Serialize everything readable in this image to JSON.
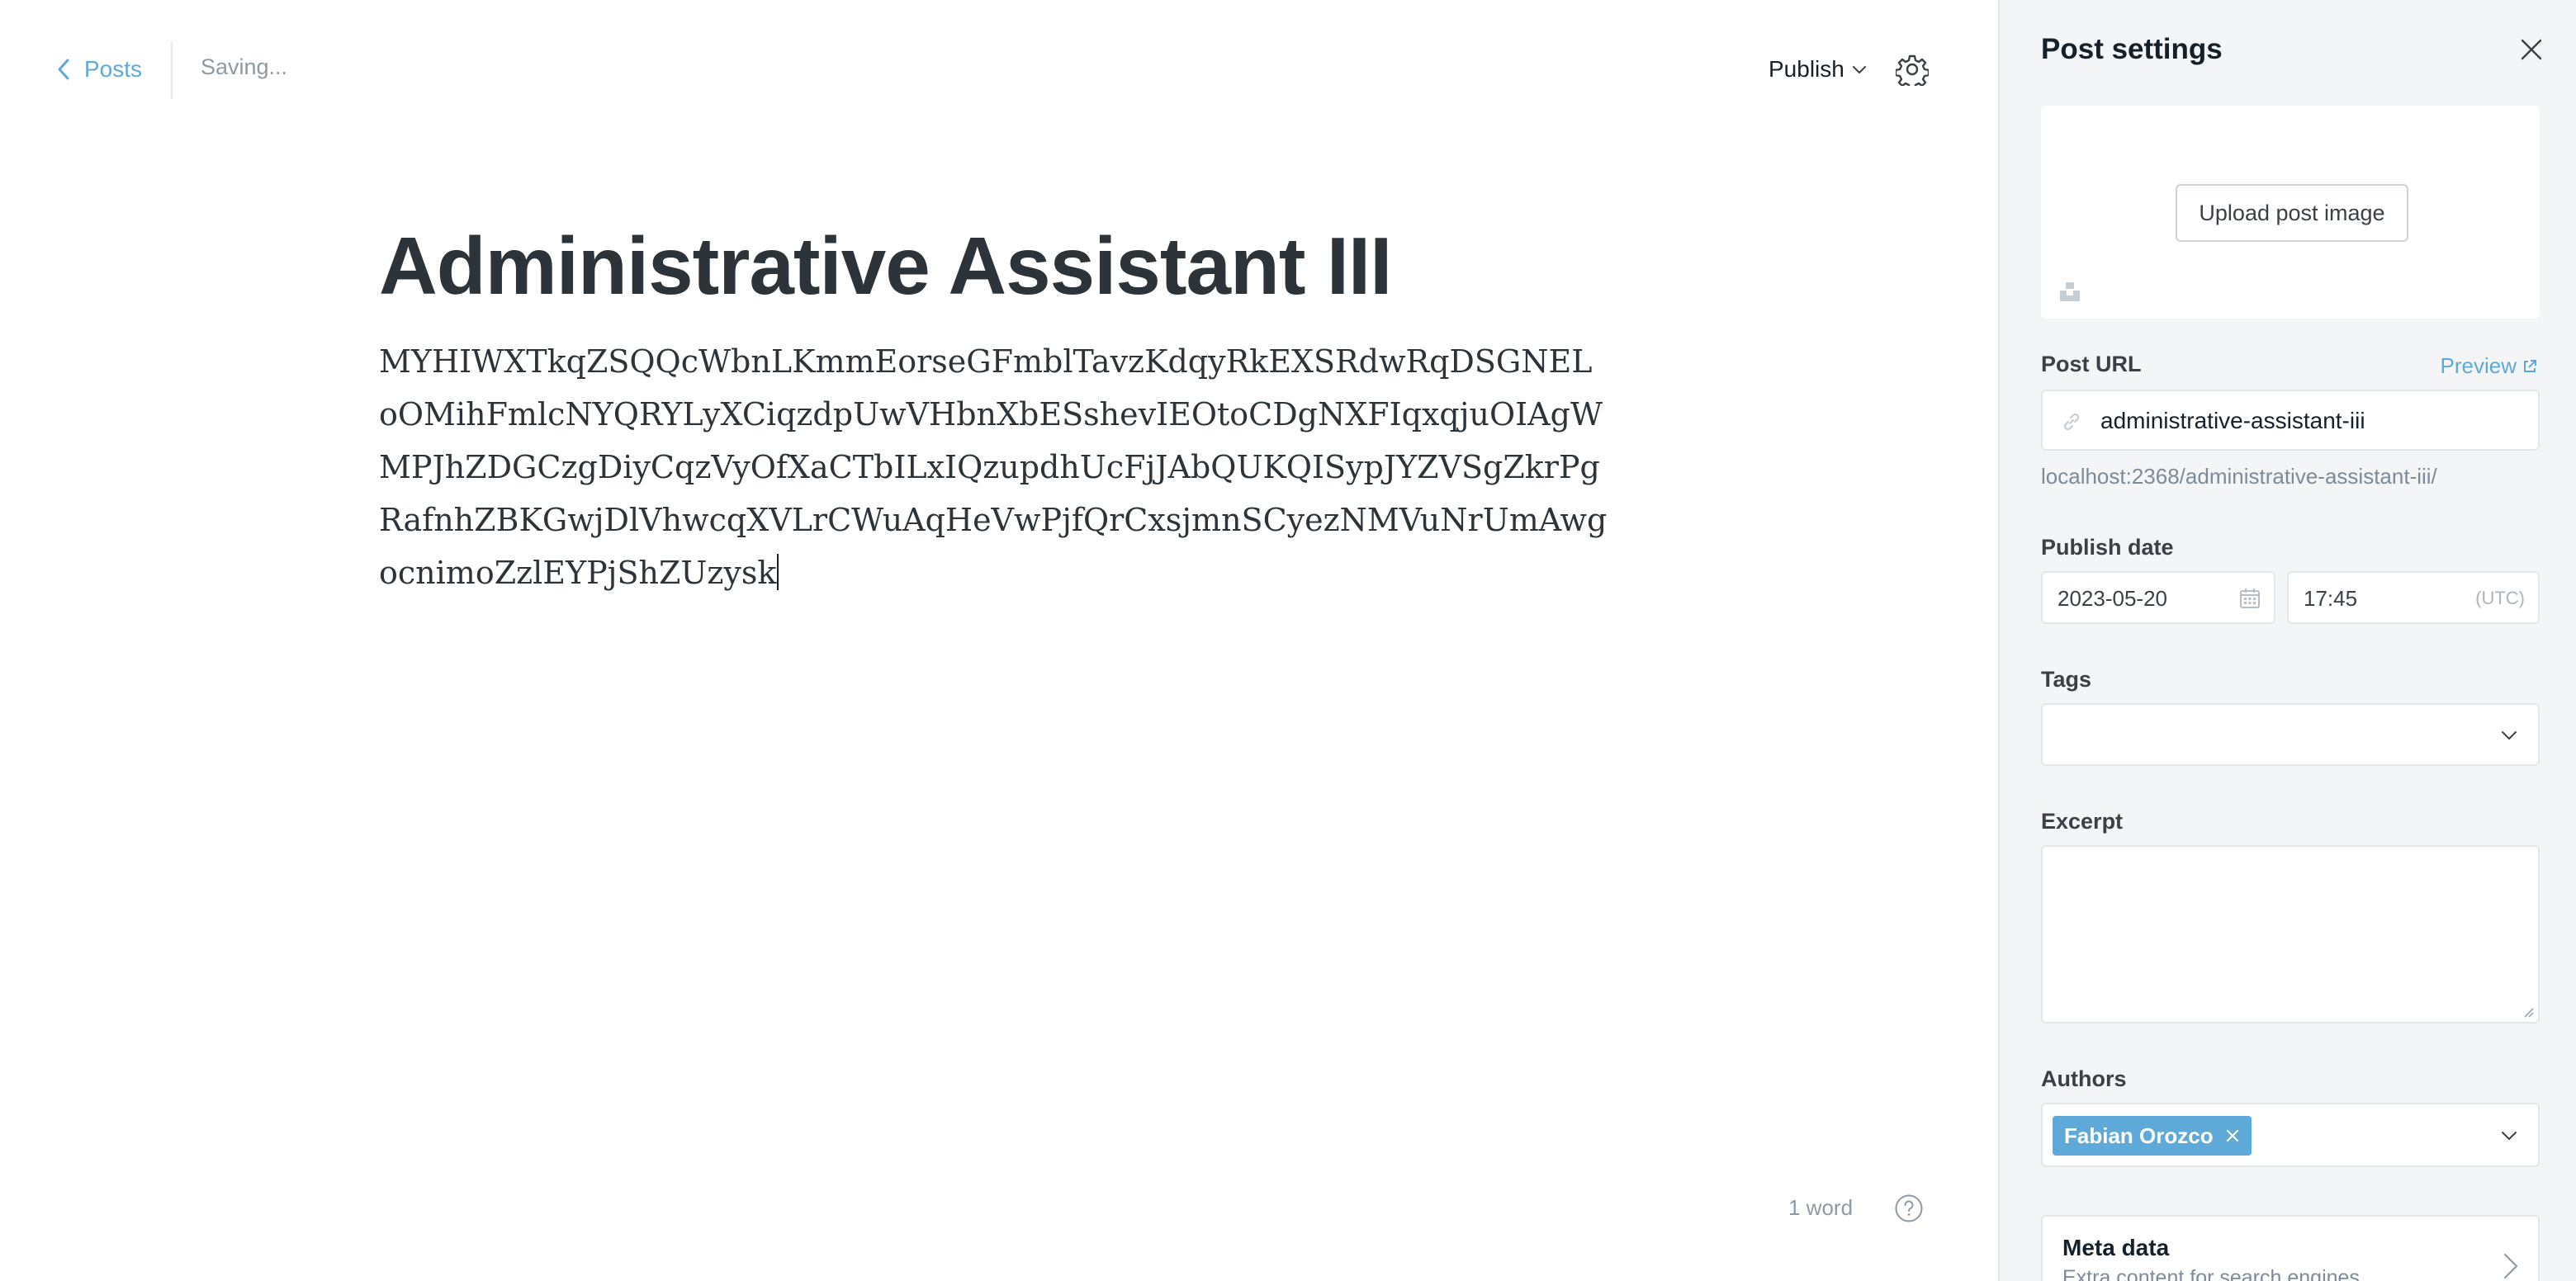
{
  "header": {
    "back_label": "Posts",
    "status": "Saving...",
    "publish_label": "Publish"
  },
  "post": {
    "title": "Administrative Assistant III",
    "body": "MYHIWXTkqZSQQcWbnLKmmEorseGFmblTavzKdqyRkEXSRdwRqDSGNELoOMihFmlcNYQRYLyXCiqzdpUwVHbnXbESshevIEOtoCDgNXFIqxqjuOIAgWMPJhZDGCzgDiyCqzVyOfXaCTbILxIQzupdhUcFjJAbQUKQISypJYZVSgZkrPgRafnhZBKGwjDlVhwcqXVLrCWuAqHeVwPjfQrCxsjmnSCyezNMVuNrUmAwgocnimoZzlEYPjShZUzysk",
    "word_count": "1 word"
  },
  "sidebar": {
    "title": "Post settings",
    "upload_label": "Upload post image",
    "url_label": "Post URL",
    "preview_label": "Preview",
    "url_value": "administrative-assistant-iii",
    "url_hint": "localhost:2368/administrative-assistant-iii/",
    "publish_date_label": "Publish date",
    "date_value": "2023-05-20",
    "time_value": "17:45",
    "timezone": "(UTC)",
    "tags_label": "Tags",
    "excerpt_label": "Excerpt",
    "authors_label": "Authors",
    "author_name": "Fabian Orozco",
    "meta_title": "Meta data",
    "meta_subtitle": "Extra content for search engines"
  },
  "colors": {
    "accent": "#5fa9d8",
    "sidebar_bg": "#f4f5f6",
    "text": "#15212a"
  }
}
